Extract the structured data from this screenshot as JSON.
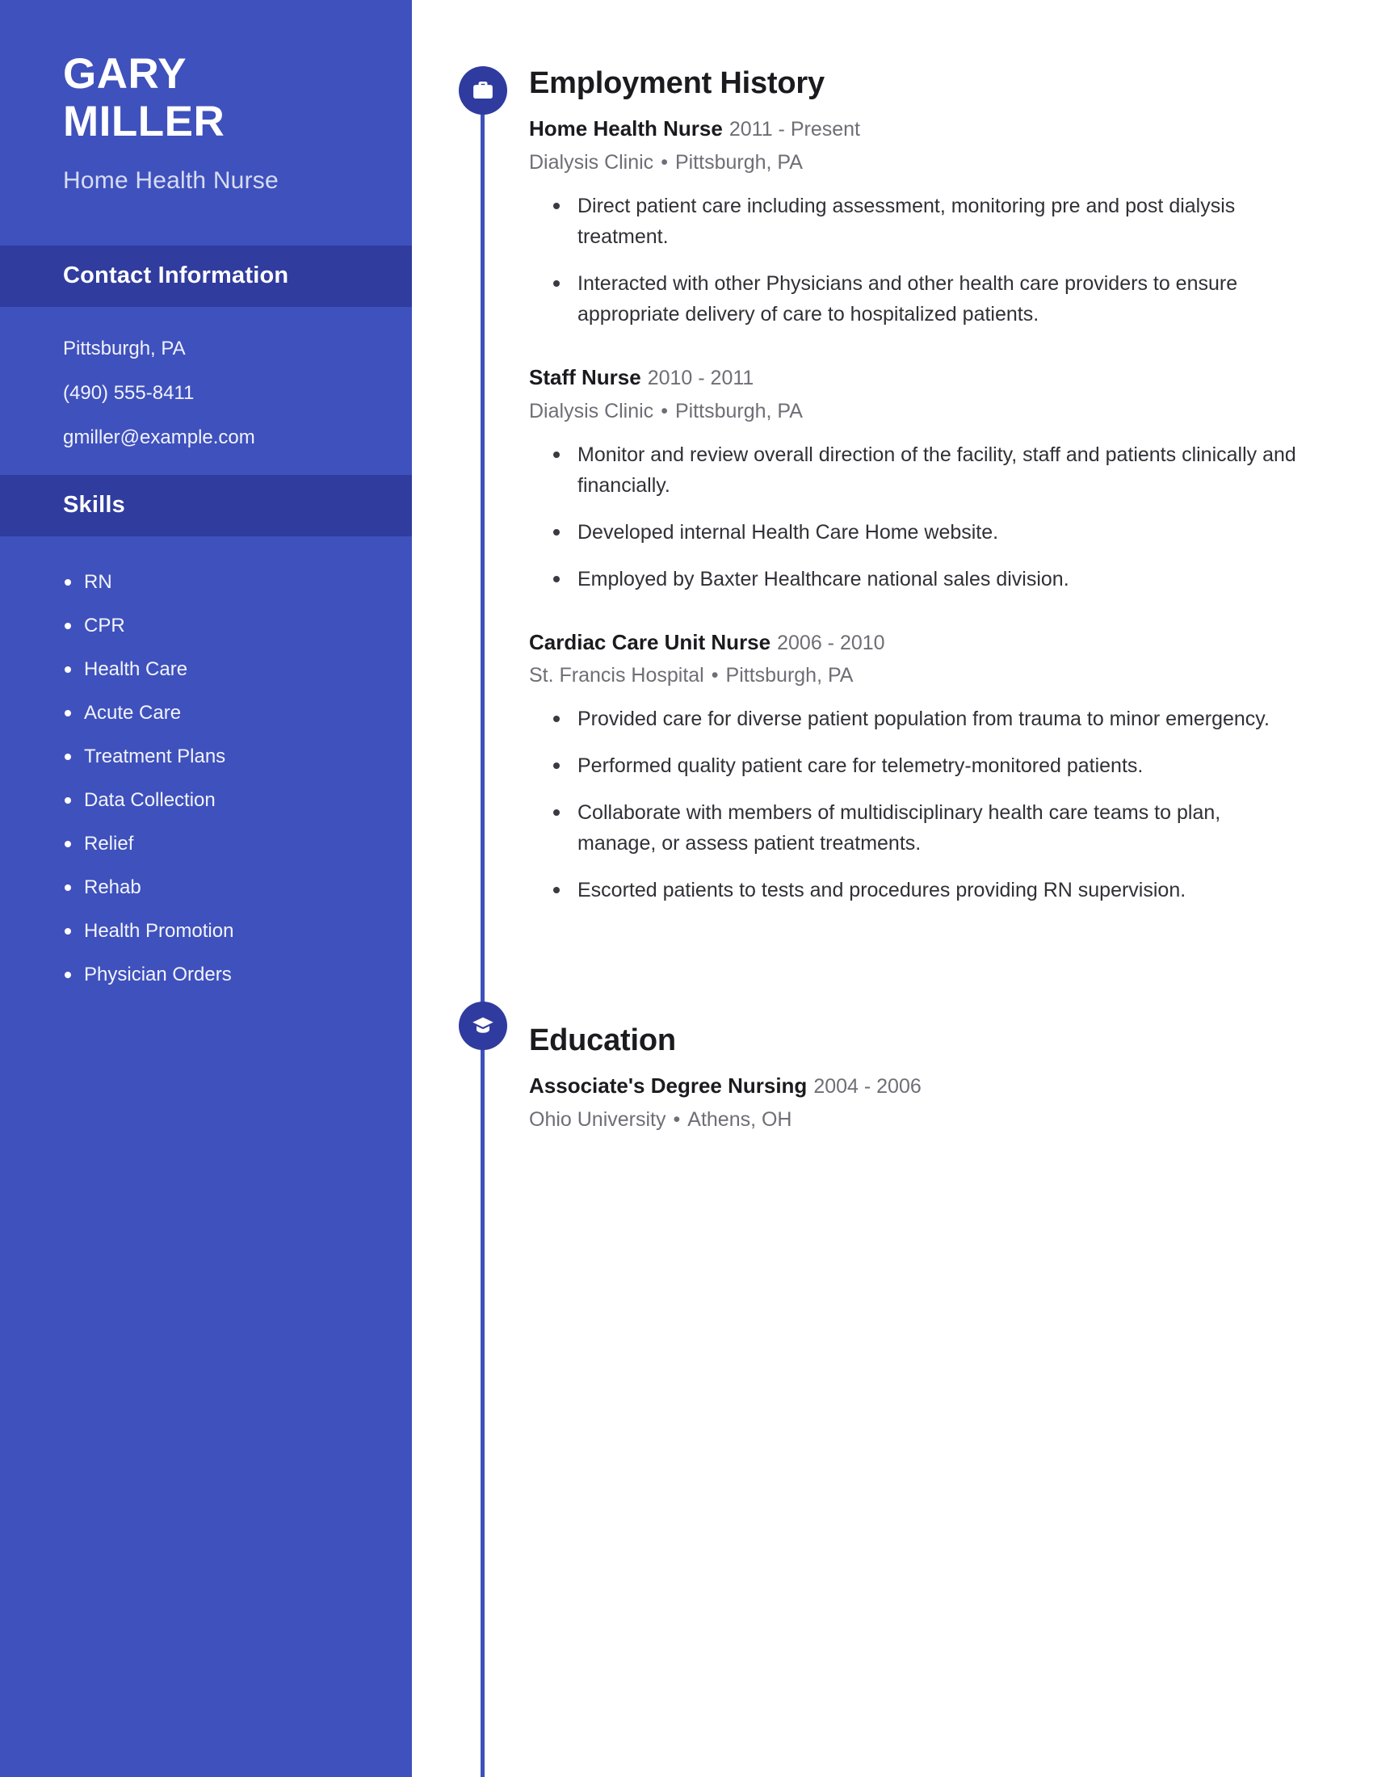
{
  "theme": {
    "sidebar_bg": "#3f51bc",
    "sidebar_header_bg": "#303c9e",
    "icon_circle": "#2f3b9e",
    "timeline_line": "#3d50bb",
    "text_dark": "#1b1b1f",
    "text_muted": "#6e6e76"
  },
  "sidebar": {
    "first_name": "GARY",
    "last_name": "MILLER",
    "job_title": "Home Health Nurse",
    "contact_header": "Contact Information",
    "contact_items": [
      "Pittsburgh, PA",
      "(490) 555-8411",
      "gmiller@example.com"
    ],
    "skills_header": "Skills",
    "skills": [
      "RN",
      "CPR",
      "Health Care",
      "Acute Care",
      "Treatment Plans",
      "Data Collection",
      "Relief",
      "Rehab",
      "Health Promotion",
      "Physician Orders"
    ]
  },
  "main": {
    "employment": {
      "icon": "briefcase-icon",
      "title": "Employment History",
      "entries": [
        {
          "role": "Home Health Nurse",
          "dates": "2011 - Present",
          "company": "Dialysis Clinic",
          "location": "Pittsburgh, PA",
          "bullets": [
            "Direct patient care including assessment, monitoring pre and post dialysis treatment.",
            "Interacted with other Physicians and other health care providers to ensure appropriate delivery of care to hospitalized patients."
          ]
        },
        {
          "role": "Staff Nurse",
          "dates": "2010 - 2011",
          "company": "Dialysis Clinic",
          "location": "Pittsburgh, PA",
          "bullets": [
            "Monitor and review overall direction of the facility, staff and patients clinically and financially.",
            "Developed internal Health Care Home website.",
            "Employed by Baxter Healthcare national sales division."
          ]
        },
        {
          "role": "Cardiac Care Unit Nurse",
          "dates": "2006 - 2010",
          "company": "St. Francis Hospital",
          "location": "Pittsburgh, PA",
          "bullets": [
            "Provided care for diverse patient population from trauma to minor emergency.",
            "Performed quality patient care for telemetry-monitored patients.",
            "Collaborate with members of multidisciplinary health care teams to plan, manage, or assess patient treatments.",
            "Escorted patients to tests and procedures providing RN supervision."
          ]
        }
      ]
    },
    "education": {
      "icon": "graduation-cap-icon",
      "title": "Education",
      "entries": [
        {
          "role": "Associate's Degree Nursing",
          "dates": "2004 - 2006",
          "company": "Ohio University",
          "location": "Athens, OH",
          "bullets": []
        }
      ]
    },
    "separator": "•"
  }
}
